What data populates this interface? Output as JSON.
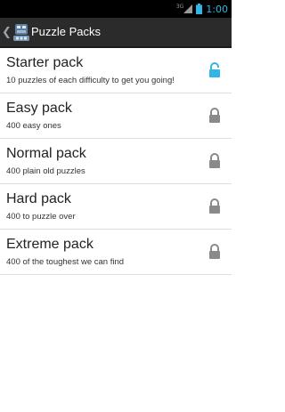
{
  "status_bar": {
    "network": "3G",
    "time": "1:00",
    "accent_color": "#33b5e5"
  },
  "action_bar": {
    "up_icon": "chevron-left-icon",
    "app_icon": "robot-puzzle-app-icon",
    "title": "Puzzle Packs"
  },
  "packs": [
    {
      "title": "Starter pack",
      "description": "10 puzzles of each difficulty to get you going!",
      "lock_state": "unlocked",
      "lock_color": "#33b5e5"
    },
    {
      "title": "Easy pack",
      "description": "400 easy ones",
      "lock_state": "locked",
      "lock_color": "#8a8a8a"
    },
    {
      "title": "Normal pack",
      "description": "400 plain old puzzles",
      "lock_state": "locked",
      "lock_color": "#8a8a8a"
    },
    {
      "title": "Hard pack",
      "description": "400 to puzzle over",
      "lock_state": "locked",
      "lock_color": "#8a8a8a"
    },
    {
      "title": "Extreme pack",
      "description": "400 of the toughest we can find",
      "lock_state": "locked",
      "lock_color": "#8a8a8a"
    }
  ]
}
